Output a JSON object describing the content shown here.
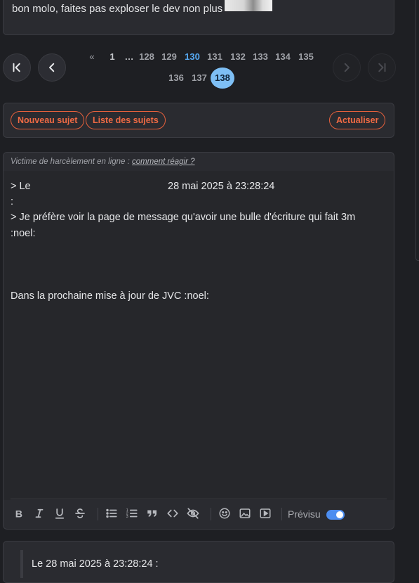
{
  "top_post": {
    "text": "bon molo, faites pas exploser le dev non plus"
  },
  "pagination": {
    "first_icon": "first-page-icon",
    "prev_icon": "chevron-left-icon",
    "next_icon": "chevron-right-icon",
    "last_icon": "last-page-icon",
    "prev_marker": "«",
    "first_page": "1",
    "ellipsis": "…",
    "pages_row1": [
      "128",
      "129",
      "130",
      "131",
      "132",
      "133",
      "134",
      "135"
    ],
    "pages_row2": [
      "136",
      "137",
      "138"
    ],
    "highlighted_page": "130",
    "current_page": "138"
  },
  "actions": {
    "new_topic": "Nouveau sujet",
    "topic_list": "Liste des sujets",
    "refresh": "Actualiser"
  },
  "editor": {
    "notice_prefix": "Victime de harcèlement en ligne :",
    "notice_link": "comment réagir ?",
    "lines": [
      "> Le",
      "28 mai 2025 à 23:28:24",
      ":",
      "> Je préfère voir la page de message qu'avoir une bulle d'écriture qui fait 3m",
      ":noel:",
      "Dans la prochaine mise à jour de JVC :noel:"
    ],
    "toolbar": {
      "icons": [
        "bold-icon",
        "italic-icon",
        "underline-icon",
        "strikethrough-icon",
        "bullet-list-icon",
        "numbered-list-icon",
        "quote-icon",
        "code-icon",
        "spoiler-icon",
        "emoji-icon",
        "image-icon",
        "video-icon"
      ],
      "preview_label": "Prévisu",
      "preview_enabled": true
    },
    "colors": {
      "accent": "#e5603c",
      "toggle": "#4c8df0",
      "current_page": "#7ebff5"
    }
  },
  "quote_preview": {
    "text": "Le 28 mai 2025 à 23:28:24 :"
  }
}
